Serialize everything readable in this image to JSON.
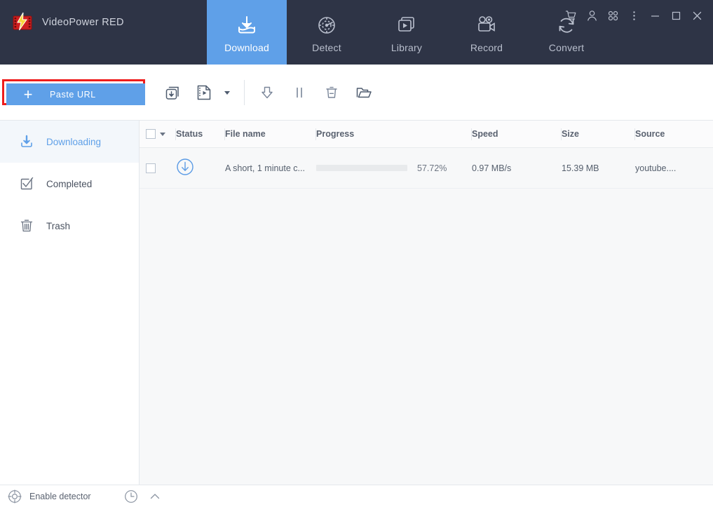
{
  "app": {
    "title": "VideoPower RED",
    "logo_icon": "videopower-logo-icon"
  },
  "header": {
    "tabs": [
      {
        "label": "Download",
        "icon": "download-tray-icon",
        "active": true
      },
      {
        "label": "Detect",
        "icon": "detect-radar-icon",
        "active": false
      },
      {
        "label": "Library",
        "icon": "library-play-icon",
        "active": false
      },
      {
        "label": "Record",
        "icon": "record-camera-icon",
        "active": false
      },
      {
        "label": "Convert",
        "icon": "convert-refresh-icon",
        "active": false
      }
    ],
    "window_controls": [
      {
        "name": "cart-icon",
        "title": "Store"
      },
      {
        "name": "user-icon",
        "title": "Account"
      },
      {
        "name": "grid-command-icon",
        "title": "Apps"
      },
      {
        "name": "kebab-menu-icon",
        "title": "Menu"
      },
      {
        "name": "minimize-icon",
        "title": "Minimize"
      },
      {
        "name": "maximize-icon",
        "title": "Maximize"
      },
      {
        "name": "close-icon",
        "title": "Close"
      }
    ],
    "colors": {
      "background": "#2e3446",
      "active_tab": "#5fa0e8",
      "tab_text": "#b9bfcd"
    }
  },
  "toolbar": {
    "paste_url_label": "Paste URL",
    "paste_plus": "+",
    "highlight_color": "#ee1c1c",
    "button_color": "#5fa0e8",
    "icons": [
      {
        "name": "batch-download-icon"
      },
      {
        "name": "video-file-icon"
      },
      {
        "name": "dropdown-caret-icon"
      },
      {
        "name": "start-download-icon"
      },
      {
        "name": "pause-download-icon"
      },
      {
        "name": "delete-icon"
      },
      {
        "name": "open-folder-icon"
      }
    ]
  },
  "sidebar": {
    "items": [
      {
        "label": "Downloading",
        "icon": "downloading-icon",
        "active": true
      },
      {
        "label": "Completed",
        "icon": "completed-check-icon",
        "active": false
      },
      {
        "label": "Trash",
        "icon": "trash-icon",
        "active": false
      }
    ],
    "active_color": "#5fa0e8",
    "active_background": "#f3f7fb"
  },
  "table": {
    "columns": [
      "Status",
      "File name",
      "Progress",
      "Speed",
      "Size",
      "Source"
    ],
    "rows": [
      {
        "status_icon": "download-circle-icon",
        "file_name": "A short, 1 minute c...",
        "progress_percent": "57.72%",
        "progress_value": 57.72,
        "speed": "0.97 MB/s",
        "size": "15.39 MB",
        "source": "youtube...."
      }
    ],
    "progress_fill_color": "#5b9be5",
    "progress_track_color": "#e8eaec"
  },
  "statusbar": {
    "detector_label": "Enable detector",
    "detector_icon": "detector-target-icon",
    "clock_icon": "clock-icon",
    "chevron_icon": "chevron-up-icon"
  }
}
